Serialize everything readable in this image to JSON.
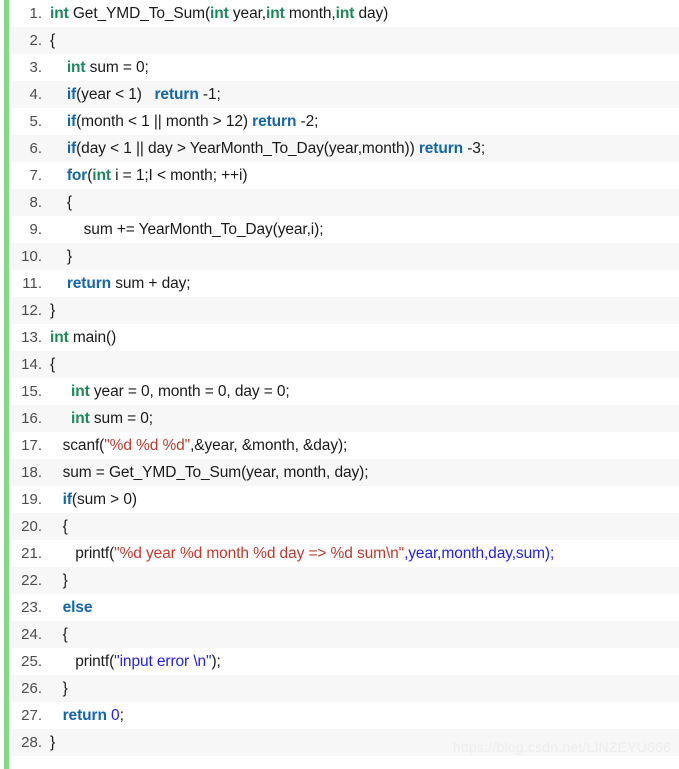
{
  "code_block": {
    "language": "c",
    "accent_color": "#7fdc84",
    "background": "#ffffff",
    "alt_row_background": "#f7f7f7",
    "colors": {
      "type_keyword": "#1a8a5a",
      "control_keyword": "#1266ad",
      "string_red": "#c0392b",
      "string_blue": "#2222e8",
      "plain_text": "#1b1b1b",
      "line_number": "#4d4d4d",
      "watermark": "#eceded"
    },
    "lines": [
      {
        "number": "1.",
        "text": "int Get_YMD_To_Sum(int year,int month,int day)"
      },
      {
        "number": "2.",
        "text": "{"
      },
      {
        "number": "3.",
        "text": "    int sum = 0;"
      },
      {
        "number": "4.",
        "text": "    if(year < 1)   return -1;"
      },
      {
        "number": "5.",
        "text": "    if(month < 1 || month > 12) return -2;"
      },
      {
        "number": "6.",
        "text": "    if(day < 1 || day > YearMonth_To_Day(year,month)) return -3;"
      },
      {
        "number": "7.",
        "text": "    for(int i = 1;I < month; ++i)"
      },
      {
        "number": "8.",
        "text": "    {"
      },
      {
        "number": "9.",
        "text": "        sum += YearMonth_To_Day(year,i);"
      },
      {
        "number": "10.",
        "text": "    }"
      },
      {
        "number": "11.",
        "text": "    return sum + day;"
      },
      {
        "number": "12.",
        "text": "}"
      },
      {
        "number": "13.",
        "text": "int main()"
      },
      {
        "number": "14.",
        "text": "{"
      },
      {
        "number": "15.",
        "text": "     int year = 0, month = 0, day = 0;"
      },
      {
        "number": "16.",
        "text": "     int sum = 0;"
      },
      {
        "number": "17.",
        "text": "   scanf(\"%d %d %d\",&year, &month, &day);"
      },
      {
        "number": "18.",
        "text": "   sum = Get_YMD_To_Sum(year, month, day);"
      },
      {
        "number": "19.",
        "text": "   if(sum > 0)"
      },
      {
        "number": "20.",
        "text": "   {"
      },
      {
        "number": "21.",
        "text": "      printf(\"%d year %d month %d day => %d sum\\n\",year,month,day,sum);"
      },
      {
        "number": "22.",
        "text": "   }"
      },
      {
        "number": "23.",
        "text": "   else"
      },
      {
        "number": "24.",
        "text": "   {"
      },
      {
        "number": "25.",
        "text": "      printf(\"input error \\n\");"
      },
      {
        "number": "26.",
        "text": "   }"
      },
      {
        "number": "27.",
        "text": "   return 0;"
      },
      {
        "number": "28.",
        "text": "}"
      }
    ],
    "tokens": [
      [
        {
          "t": "int",
          "c": "kw-type"
        },
        {
          "t": " Get_YMD_To_Sum(",
          "c": "plain"
        },
        {
          "t": "int",
          "c": "kw-type"
        },
        {
          "t": " year,",
          "c": "plain"
        },
        {
          "t": "int",
          "c": "kw-type"
        },
        {
          "t": " month,",
          "c": "plain"
        },
        {
          "t": "int",
          "c": "kw-type"
        },
        {
          "t": " day)",
          "c": "plain"
        }
      ],
      [
        {
          "t": "{",
          "c": "plain"
        }
      ],
      [
        {
          "t": "    ",
          "c": "plain"
        },
        {
          "t": "int",
          "c": "kw-type"
        },
        {
          "t": " sum = 0;",
          "c": "plain"
        }
      ],
      [
        {
          "t": "    ",
          "c": "plain"
        },
        {
          "t": "if",
          "c": "kw-ctrl"
        },
        {
          "t": "(year < 1)   ",
          "c": "plain"
        },
        {
          "t": "return",
          "c": "kw-ctrl"
        },
        {
          "t": " -1;",
          "c": "plain"
        }
      ],
      [
        {
          "t": "    ",
          "c": "plain"
        },
        {
          "t": "if",
          "c": "kw-ctrl"
        },
        {
          "t": "(month < 1 || month > 12) ",
          "c": "plain"
        },
        {
          "t": "return",
          "c": "kw-ctrl"
        },
        {
          "t": " -2;",
          "c": "plain"
        }
      ],
      [
        {
          "t": "    ",
          "c": "plain"
        },
        {
          "t": "if",
          "c": "kw-ctrl"
        },
        {
          "t": "(day < 1 || day > YearMonth_To_Day(year,month)) ",
          "c": "plain"
        },
        {
          "t": "return",
          "c": "kw-ctrl"
        },
        {
          "t": " -3;",
          "c": "plain"
        }
      ],
      [
        {
          "t": "    ",
          "c": "plain"
        },
        {
          "t": "for",
          "c": "kw-ctrl"
        },
        {
          "t": "(",
          "c": "plain"
        },
        {
          "t": "int",
          "c": "kw-type"
        },
        {
          "t": " i = 1;I < month; ++i)",
          "c": "plain"
        }
      ],
      [
        {
          "t": "    {",
          "c": "plain"
        }
      ],
      [
        {
          "t": "        sum += YearMonth_To_Day(year,i);",
          "c": "plain"
        }
      ],
      [
        {
          "t": "    }",
          "c": "plain"
        }
      ],
      [
        {
          "t": "    ",
          "c": "plain"
        },
        {
          "t": "return",
          "c": "kw-ctrl"
        },
        {
          "t": " sum + day;",
          "c": "plain"
        }
      ],
      [
        {
          "t": "}",
          "c": "plain"
        }
      ],
      [
        {
          "t": "int",
          "c": "kw-type"
        },
        {
          "t": " main()",
          "c": "plain"
        }
      ],
      [
        {
          "t": "{",
          "c": "plain"
        }
      ],
      [
        {
          "t": "     ",
          "c": "plain"
        },
        {
          "t": "int",
          "c": "kw-type"
        },
        {
          "t": " year = 0, month = 0, day = 0;",
          "c": "plain"
        }
      ],
      [
        {
          "t": "     ",
          "c": "plain"
        },
        {
          "t": "int",
          "c": "kw-type"
        },
        {
          "t": " sum = 0;",
          "c": "plain"
        }
      ],
      [
        {
          "t": "   scanf(",
          "c": "plain"
        },
        {
          "t": "\"%d %d %d\"",
          "c": "str-red"
        },
        {
          "t": ",&year, &month, &day);",
          "c": "plain"
        }
      ],
      [
        {
          "t": "   sum = Get_YMD_To_Sum(year, month, day);",
          "c": "plain"
        }
      ],
      [
        {
          "t": "   ",
          "c": "plain"
        },
        {
          "t": "if",
          "c": "kw-ctrl"
        },
        {
          "t": "(sum > 0)",
          "c": "plain"
        }
      ],
      [
        {
          "t": "   {",
          "c": "plain"
        }
      ],
      [
        {
          "t": "      printf(",
          "c": "plain"
        },
        {
          "t": "\"%d year %d month %d day => %d sum\\n\"",
          "c": "str-red"
        },
        {
          "t": ",year,month,day,sum);",
          "c": "blue"
        }
      ],
      [
        {
          "t": "   }",
          "c": "plain"
        }
      ],
      [
        {
          "t": "   ",
          "c": "plain"
        },
        {
          "t": "else",
          "c": "kw-ctrl"
        }
      ],
      [
        {
          "t": "   {",
          "c": "plain"
        }
      ],
      [
        {
          "t": "      printf(",
          "c": "plain"
        },
        {
          "t": "\"input error \\n\"",
          "c": "str-blue"
        },
        {
          "t": ");",
          "c": "plain"
        }
      ],
      [
        {
          "t": "   }",
          "c": "plain"
        }
      ],
      [
        {
          "t": "   ",
          "c": "plain"
        },
        {
          "t": "return",
          "c": "kw-ctrl"
        },
        {
          "t": " ",
          "c": "plain"
        },
        {
          "t": "0",
          "c": "blue"
        },
        {
          "t": ";",
          "c": "plain"
        }
      ],
      [
        {
          "t": "}",
          "c": "plain"
        }
      ]
    ]
  },
  "watermark": {
    "text": "https://blog.csdn.net/LINZEYU666"
  }
}
